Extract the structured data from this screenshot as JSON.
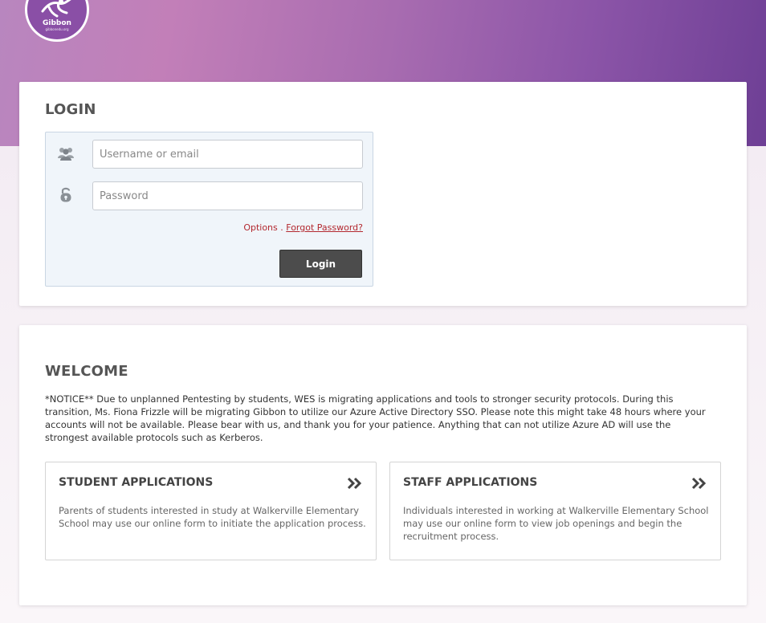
{
  "header": {
    "logo_name": "Gibbon",
    "logo_subtitle": "gibbonedu.org"
  },
  "login": {
    "title": "LOGIN",
    "username_placeholder": "Username or email",
    "password_placeholder": "Password",
    "options_label": "Options",
    "separator": ".",
    "forgot_label": "Forgot Password?",
    "submit_label": "Login"
  },
  "welcome": {
    "title": "WELCOME",
    "notice": "*NOTICE** Due to unplanned Pentesting by students, WES is migrating applications and tools to stronger security protocols. During this transition, Ms. Fiona Frizzle will be migrating Gibbon to utilize our Azure Active Directory SSO. Please note this might take 48 hours where your accounts will not be available. Please bear with us, and thank you for your patience. Anything that can not utilize Azure AD will use the strongest available protocols such as Kerberos."
  },
  "applications": [
    {
      "title": "STUDENT APPLICATIONS",
      "description": "Parents of students interested in study at Walkerville Elementary School may use our online form to initiate the application process."
    },
    {
      "title": "STAFF APPLICATIONS",
      "description": "Individuals interested in working at Walkerville Elementary School may use our online form to view job openings and begin the recruitment process."
    }
  ],
  "colors": {
    "brand_purple": "#8a4fa6",
    "link_red": "#b3282f",
    "button_dark": "#4c4c4c",
    "login_box_bg": "#f0f5fa"
  },
  "icons": [
    "users-icon",
    "lock-icon",
    "double-chevron-right-icon"
  ]
}
